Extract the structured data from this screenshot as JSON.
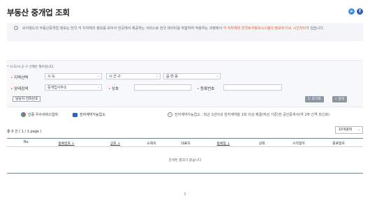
{
  "header": {
    "title": "부동산 중개업 조회",
    "icons": [
      "facebook-icon",
      "share-icon"
    ]
  },
  "notice": {
    "text_normal": "브이월드의 부동산중개업 정보는 전국 각 지자체의 정보를 모아서 한곳에서 제공하는 서비스로 전국 데이터를 취합하여 적용하는 과정에서 ",
    "text_highlight": "각 지자체와 한국토지정보시스템의 정보와 다소 시간차이",
    "text_tail": "가 있습니다."
  },
  "search": {
    "required_note_star": "* ",
    "required_note": "시·도/시·군·구 선택은 필수입니다.",
    "region_label": "지역선택",
    "sido_value": "시·도",
    "sigungu_value": "시·군·구",
    "emd_value": "읍·면·동",
    "status_label": "상태검색",
    "status_value": "중개업사무소",
    "name_label": "상호",
    "regno_label": "등록번호",
    "contact_button": "담당자 전화번호",
    "reset_button": "초기화",
    "search_button": "검색",
    "legend_excellent": "인증 우수서비스업자",
    "legend_econtract": "전자계약가능업소",
    "econtract_note": "전자계약가능업소 : 최근 1년이내 전자계약을 1회 이상 체결(작성 기준)한 공인중개사(약 2주 간격 최신화)"
  },
  "results": {
    "count_text": "총 0 건  ( 1 / 1 page )",
    "per_page": "10개출력",
    "columns": [
      "No.",
      "등록번호 ↓",
      "상호 ↓",
      "소재지",
      "대표자",
      "등록일 ↓",
      "상태",
      "시작일자",
      "종료일자"
    ],
    "empty_message": "검색된 결과가 없습니다"
  },
  "pagination": {
    "current": "1"
  },
  "colors": {
    "accent_blue": "#3a6fd8",
    "notice_highlight": "#e85a2a",
    "table_border": "#6b7fa8",
    "button_gray": "#8e96a3"
  }
}
